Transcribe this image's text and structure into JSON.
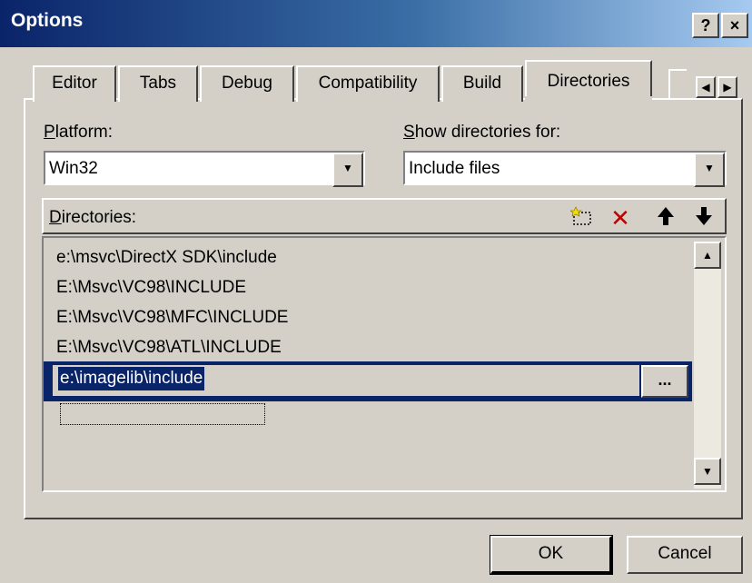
{
  "window": {
    "title": "Options",
    "help_label": "?",
    "close_label": "×"
  },
  "tabs": [
    {
      "label": "Editor",
      "active": false
    },
    {
      "label": "Tabs",
      "active": false
    },
    {
      "label": "Debug",
      "active": false
    },
    {
      "label": "Compatibility",
      "active": false
    },
    {
      "label": "Build",
      "active": false
    },
    {
      "label": "Directories",
      "active": true
    }
  ],
  "platform": {
    "label_mnemonic": "P",
    "label_rest": "latform:",
    "value": "Win32"
  },
  "show_for": {
    "label_mnemonic": "S",
    "label_rest": "how directories for:",
    "value": "Include files"
  },
  "directories": {
    "label_mnemonic": "D",
    "label_rest": "irectories:",
    "items": [
      "e:\\msvc\\DirectX SDK\\include",
      "E:\\Msvc\\VC98\\INCLUDE",
      "E:\\Msvc\\VC98\\MFC\\INCLUDE",
      "E:\\Msvc\\VC98\\ATL\\INCLUDE"
    ],
    "editing_value": "e:\\imagelib\\include",
    "browse_label": "...",
    "toolbar": {
      "new_icon": "new-folder-icon",
      "delete_icon": "delete-x-icon",
      "up_icon": "arrow-up-icon",
      "down_icon": "arrow-down-icon"
    }
  },
  "buttons": {
    "ok": "OK",
    "cancel": "Cancel"
  },
  "colors": {
    "title_start": "#0a246a",
    "title_end": "#a6caf0",
    "selection": "#0a246a",
    "delete_red": "#c00000",
    "face": "#d4d0c8"
  }
}
